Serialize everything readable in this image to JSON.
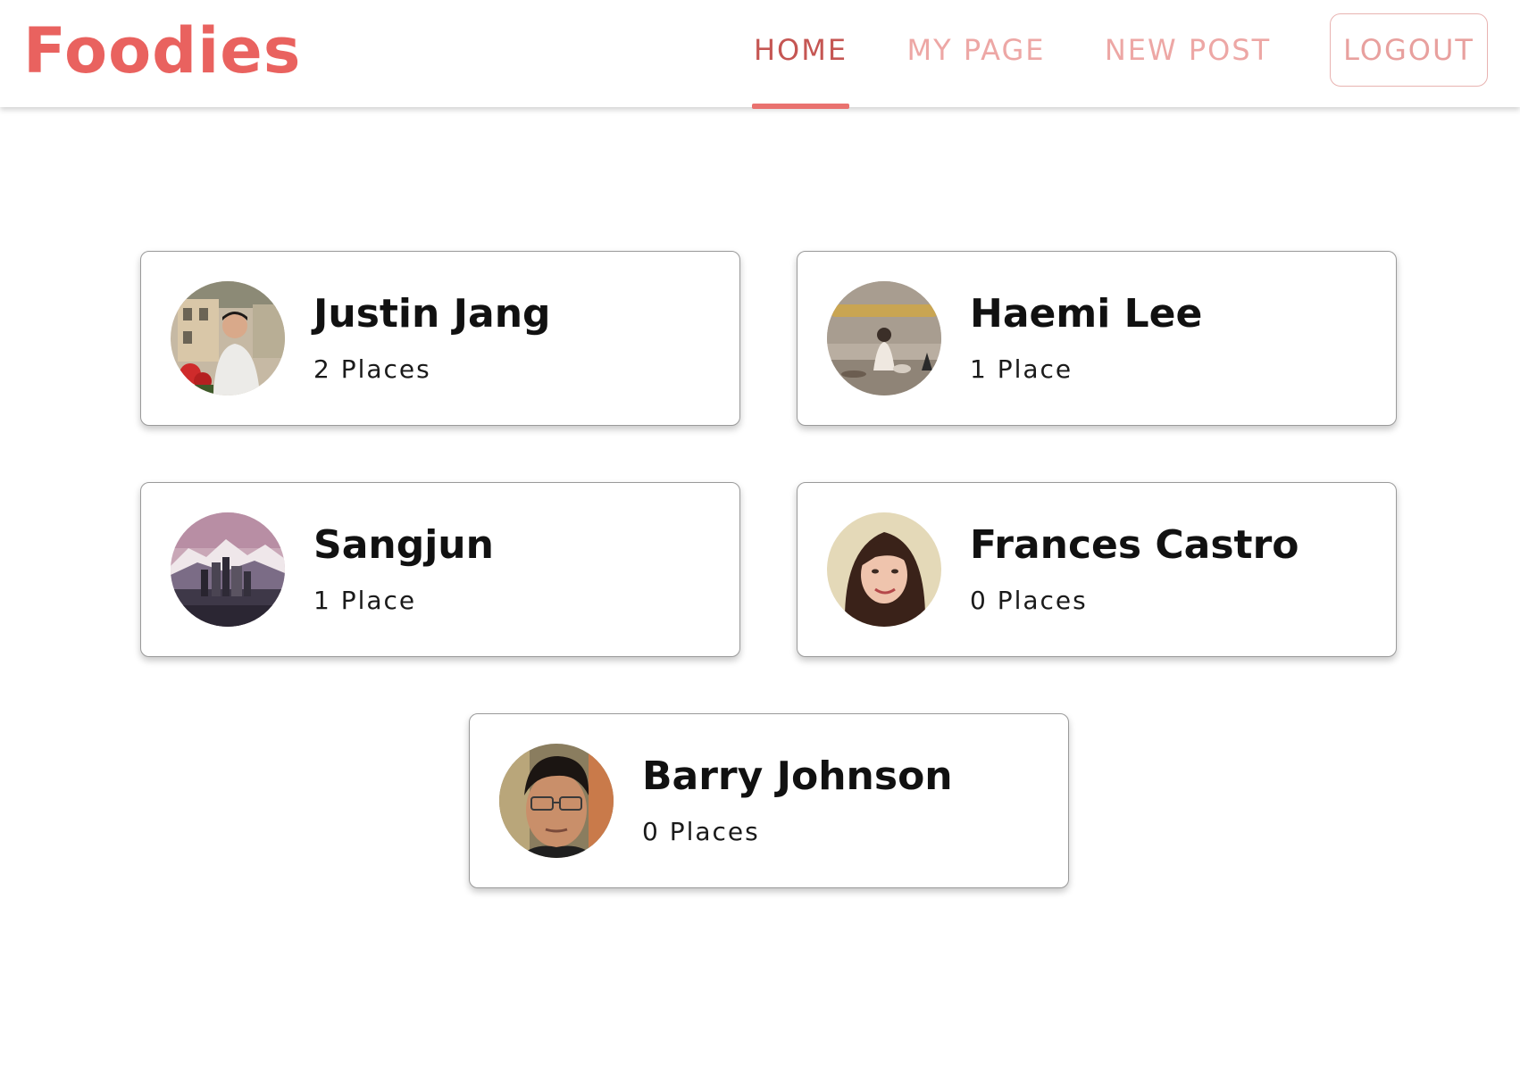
{
  "app": {
    "logo": "Foodies",
    "accent_color": "#e9625f"
  },
  "nav": {
    "items": [
      {
        "label": "HOME",
        "active": true
      },
      {
        "label": "MY PAGE",
        "active": false
      },
      {
        "label": "NEW POST",
        "active": false
      }
    ],
    "logout_label": "LOGOUT"
  },
  "users": [
    {
      "name": "Justin Jang",
      "places": "2 Places",
      "avatar": "avatar-photo"
    },
    {
      "name": "Haemi Lee",
      "places": "1 Place",
      "avatar": "avatar-photo"
    },
    {
      "name": "Sangjun",
      "places": "1 Place",
      "avatar": "avatar-photo"
    },
    {
      "name": "Frances Castro",
      "places": "0 Places",
      "avatar": "avatar-photo"
    },
    {
      "name": "Barry Johnson",
      "places": "0 Places",
      "avatar": "avatar-photo"
    }
  ]
}
